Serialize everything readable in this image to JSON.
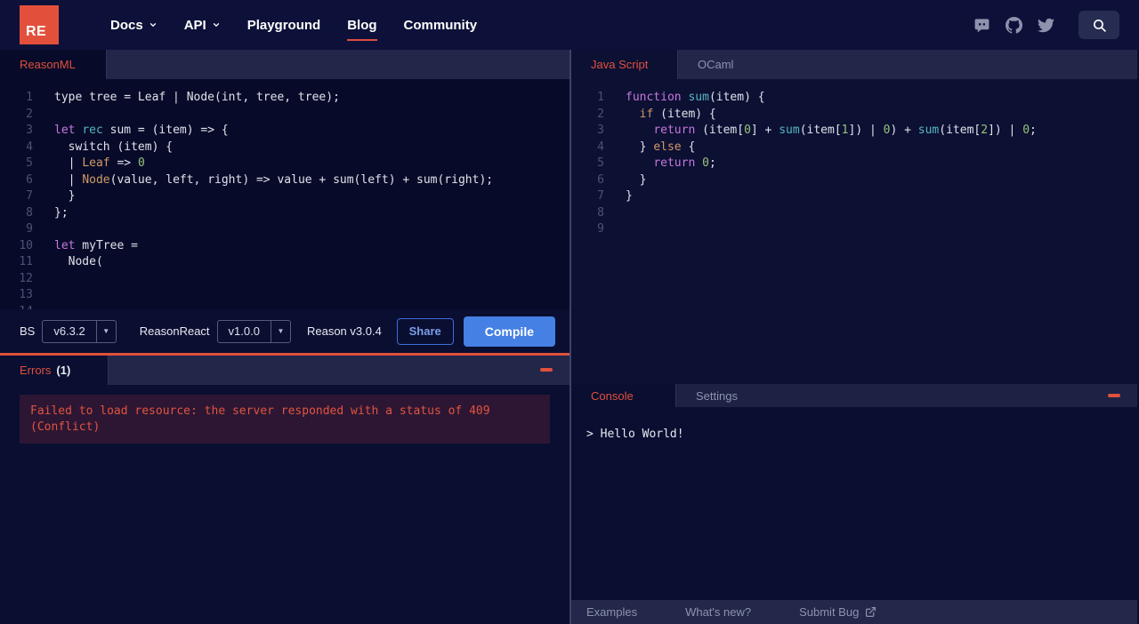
{
  "nav": {
    "logo_text": "RE",
    "items": [
      {
        "label": "Docs",
        "chevron": true
      },
      {
        "label": "API",
        "chevron": true
      },
      {
        "label": "Playground",
        "chevron": false
      },
      {
        "label": "Blog",
        "chevron": false,
        "active": true
      },
      {
        "label": "Community",
        "chevron": false
      }
    ],
    "icons": [
      "discord-icon",
      "github-icon",
      "twitter-icon",
      "search-icon"
    ]
  },
  "left": {
    "tabs": [
      {
        "label": "ReasonML",
        "active": true
      }
    ],
    "editor_lines": [
      [
        [
          "d",
          "type tree = Leaf | Node(int, tree, tree);"
        ]
      ],
      [],
      [
        [
          "kw",
          "let"
        ],
        [
          "d",
          " "
        ],
        [
          "cy",
          "rec"
        ],
        [
          "d",
          " sum = (item) => {"
        ]
      ],
      [
        [
          "d",
          "  switch (item) {"
        ]
      ],
      [
        [
          "d",
          "  | "
        ],
        [
          "or",
          "Leaf"
        ],
        [
          "d",
          " => "
        ],
        [
          "gr",
          "0"
        ]
      ],
      [
        [
          "d",
          "  | "
        ],
        [
          "or",
          "Node"
        ],
        [
          "d",
          "(value, left, right) => value + sum(left) + sum(right);"
        ]
      ],
      [
        [
          "d",
          "  }"
        ]
      ],
      [
        [
          "d",
          "};"
        ]
      ],
      [],
      [
        [
          "kw",
          "let"
        ],
        [
          "d",
          " myTree ="
        ]
      ],
      [
        [
          "d",
          "  Node("
        ]
      ],
      [],
      [],
      [],
      [],
      [],
      [],
      []
    ],
    "toolbar": {
      "bs_label": "BS",
      "bs_version": "v6.3.2",
      "reason_react_label": "ReasonReact",
      "reason_react_version": "v1.0.0",
      "reason_version": "Reason v3.0.4",
      "share_label": "Share",
      "compile_label": "Compile"
    },
    "errors": {
      "title": "Errors",
      "count": "(1)",
      "message": "Failed to load resource: the server responded with a status of 409 (Conflict)"
    }
  },
  "right": {
    "tabs": [
      {
        "label": "Java Script",
        "active": true
      },
      {
        "label": "OCaml",
        "active": false
      }
    ],
    "editor_lines": [
      [
        [
          "kw",
          "function"
        ],
        [
          "d",
          " "
        ],
        [
          "cy",
          "sum"
        ],
        [
          "d",
          "(item) {"
        ]
      ],
      [
        [
          "d",
          "  "
        ],
        [
          "or",
          "if"
        ],
        [
          "d",
          " (item) {"
        ]
      ],
      [
        [
          "d",
          "    "
        ],
        [
          "kw",
          "return"
        ],
        [
          "d",
          " (item["
        ],
        [
          "gr",
          "0"
        ],
        [
          "d",
          "] + "
        ],
        [
          "cy",
          "sum"
        ],
        [
          "d",
          "(item["
        ],
        [
          "gr",
          "1"
        ],
        [
          "d",
          "]) | "
        ],
        [
          "gr",
          "0"
        ],
        [
          "d",
          ") + "
        ],
        [
          "cy",
          "sum"
        ],
        [
          "d",
          "(item["
        ],
        [
          "gr",
          "2"
        ],
        [
          "d",
          "]) | "
        ],
        [
          "gr",
          "0"
        ],
        [
          "d",
          ";"
        ]
      ],
      [
        [
          "d",
          "  } "
        ],
        [
          "or",
          "else"
        ],
        [
          "d",
          " {"
        ]
      ],
      [
        [
          "d",
          "    "
        ],
        [
          "kw",
          "return"
        ],
        [
          "d",
          " "
        ],
        [
          "gr",
          "0"
        ],
        [
          "d",
          ";"
        ]
      ],
      [
        [
          "d",
          "  }"
        ]
      ],
      [
        [
          "d",
          "}"
        ]
      ],
      [],
      []
    ],
    "console": {
      "tabs": [
        {
          "label": "Console",
          "active": true
        },
        {
          "label": "Settings",
          "active": false
        }
      ],
      "output": "> Hello World!"
    },
    "footer": {
      "items": [
        "Examples",
        "What's new?",
        "Submit Bug"
      ]
    }
  },
  "colors": {
    "accent_red": "#e0503c",
    "brand_red": "#db4d3f",
    "compile_blue": "#4580e4",
    "error_box_bg": "#2c1634",
    "error_text": "#e2543e",
    "token_keyword": "#c678dd",
    "token_builtin": "#56b6c2",
    "token_constructor": "#d19a66",
    "token_number": "#98c379"
  }
}
